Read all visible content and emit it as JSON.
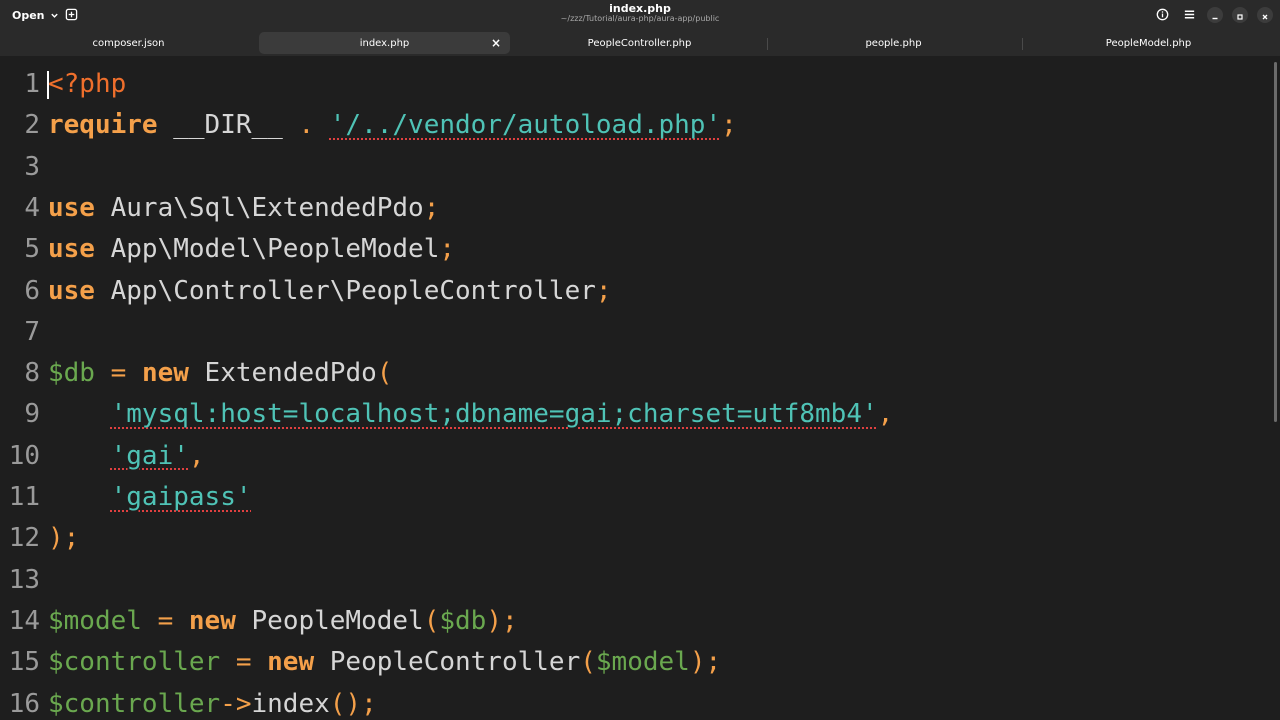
{
  "header": {
    "open_label": "Open",
    "title": "index.php",
    "subtitle": "~/zzz/Tutorial/aura-php/aura-app/public"
  },
  "tabs": [
    {
      "label": "composer.json",
      "active": false
    },
    {
      "label": "index.php",
      "active": true
    },
    {
      "label": "PeopleController.php",
      "active": false
    },
    {
      "label": "people.php",
      "active": false
    },
    {
      "label": "PeopleModel.php",
      "active": false
    }
  ],
  "editor": {
    "lines": [
      {
        "n": "1",
        "tokens": [
          {
            "t": "<?php",
            "c": "tag"
          }
        ]
      },
      {
        "n": "2",
        "tokens": [
          {
            "t": "require",
            "c": "kw"
          },
          {
            "t": " __DIR__ ",
            "c": "plain"
          },
          {
            "t": ".",
            "c": "punc"
          },
          {
            "t": " ",
            "c": "plain"
          },
          {
            "t": "'/../vendor/autoload.php'",
            "c": "str"
          },
          {
            "t": ";",
            "c": "punc"
          }
        ]
      },
      {
        "n": "3",
        "tokens": []
      },
      {
        "n": "4",
        "tokens": [
          {
            "t": "use",
            "c": "kw"
          },
          {
            "t": " Aura\\Sql\\ExtendedPdo",
            "c": "plain"
          },
          {
            "t": ";",
            "c": "punc"
          }
        ]
      },
      {
        "n": "5",
        "tokens": [
          {
            "t": "use",
            "c": "kw"
          },
          {
            "t": " App\\Model\\PeopleModel",
            "c": "plain"
          },
          {
            "t": ";",
            "c": "punc"
          }
        ]
      },
      {
        "n": "6",
        "tokens": [
          {
            "t": "use",
            "c": "kw"
          },
          {
            "t": " App\\Controller\\PeopleController",
            "c": "plain"
          },
          {
            "t": ";",
            "c": "punc"
          }
        ]
      },
      {
        "n": "7",
        "tokens": []
      },
      {
        "n": "8",
        "tokens": [
          {
            "t": "$db",
            "c": "var"
          },
          {
            "t": " ",
            "c": "plain"
          },
          {
            "t": "=",
            "c": "punc"
          },
          {
            "t": " ",
            "c": "plain"
          },
          {
            "t": "new",
            "c": "kw"
          },
          {
            "t": " ExtendedPdo",
            "c": "plain"
          },
          {
            "t": "(",
            "c": "punc"
          }
        ]
      },
      {
        "n": "9",
        "tokens": [
          {
            "t": "    ",
            "c": "plain"
          },
          {
            "t": "'mysql:host=localhost;dbname=gai;charset=utf8mb4'",
            "c": "str"
          },
          {
            "t": ",",
            "c": "punc"
          }
        ]
      },
      {
        "n": "10",
        "tokens": [
          {
            "t": "    ",
            "c": "plain"
          },
          {
            "t": "'gai'",
            "c": "str"
          },
          {
            "t": ",",
            "c": "punc"
          }
        ]
      },
      {
        "n": "11",
        "tokens": [
          {
            "t": "    ",
            "c": "plain"
          },
          {
            "t": "'gaipass'",
            "c": "str"
          }
        ]
      },
      {
        "n": "12",
        "tokens": [
          {
            "t": ");",
            "c": "punc"
          }
        ]
      },
      {
        "n": "13",
        "tokens": []
      },
      {
        "n": "14",
        "tokens": [
          {
            "t": "$model",
            "c": "var"
          },
          {
            "t": " ",
            "c": "plain"
          },
          {
            "t": "=",
            "c": "punc"
          },
          {
            "t": " ",
            "c": "plain"
          },
          {
            "t": "new",
            "c": "kw"
          },
          {
            "t": " PeopleModel",
            "c": "plain"
          },
          {
            "t": "(",
            "c": "punc"
          },
          {
            "t": "$db",
            "c": "var"
          },
          {
            "t": ");",
            "c": "punc"
          }
        ]
      },
      {
        "n": "15",
        "tokens": [
          {
            "t": "$controller",
            "c": "var"
          },
          {
            "t": " ",
            "c": "plain"
          },
          {
            "t": "=",
            "c": "punc"
          },
          {
            "t": " ",
            "c": "plain"
          },
          {
            "t": "new",
            "c": "kw"
          },
          {
            "t": " PeopleController",
            "c": "plain"
          },
          {
            "t": "(",
            "c": "punc"
          },
          {
            "t": "$model",
            "c": "var"
          },
          {
            "t": ");",
            "c": "punc"
          }
        ]
      },
      {
        "n": "16",
        "tokens": [
          {
            "t": "$controller",
            "c": "var"
          },
          {
            "t": "->",
            "c": "punc"
          },
          {
            "t": "index",
            "c": "plain"
          },
          {
            "t": "();",
            "c": "punc"
          }
        ]
      }
    ]
  },
  "colors": {
    "background": "#1e1e1e",
    "headerbar": "#2a2a2a",
    "keyword": "#f4a04a",
    "php_tag": "#ef6f2c",
    "variable": "#6aa84f",
    "string": "#4fc3b6",
    "spellcheck_underline": "#e04040"
  }
}
